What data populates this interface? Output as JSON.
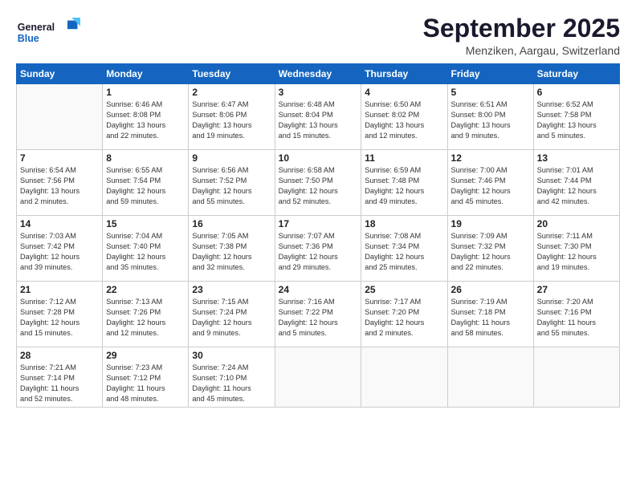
{
  "logo": {
    "general": "General",
    "blue": "Blue"
  },
  "header": {
    "month_title": "September 2025",
    "subtitle": "Menziken, Aargau, Switzerland"
  },
  "weekdays": [
    "Sunday",
    "Monday",
    "Tuesday",
    "Wednesday",
    "Thursday",
    "Friday",
    "Saturday"
  ],
  "weeks": [
    [
      {
        "day": "",
        "info": ""
      },
      {
        "day": "1",
        "info": "Sunrise: 6:46 AM\nSunset: 8:08 PM\nDaylight: 13 hours\nand 22 minutes."
      },
      {
        "day": "2",
        "info": "Sunrise: 6:47 AM\nSunset: 8:06 PM\nDaylight: 13 hours\nand 19 minutes."
      },
      {
        "day": "3",
        "info": "Sunrise: 6:48 AM\nSunset: 8:04 PM\nDaylight: 13 hours\nand 15 minutes."
      },
      {
        "day": "4",
        "info": "Sunrise: 6:50 AM\nSunset: 8:02 PM\nDaylight: 13 hours\nand 12 minutes."
      },
      {
        "day": "5",
        "info": "Sunrise: 6:51 AM\nSunset: 8:00 PM\nDaylight: 13 hours\nand 9 minutes."
      },
      {
        "day": "6",
        "info": "Sunrise: 6:52 AM\nSunset: 7:58 PM\nDaylight: 13 hours\nand 5 minutes."
      }
    ],
    [
      {
        "day": "7",
        "info": "Sunrise: 6:54 AM\nSunset: 7:56 PM\nDaylight: 13 hours\nand 2 minutes."
      },
      {
        "day": "8",
        "info": "Sunrise: 6:55 AM\nSunset: 7:54 PM\nDaylight: 12 hours\nand 59 minutes."
      },
      {
        "day": "9",
        "info": "Sunrise: 6:56 AM\nSunset: 7:52 PM\nDaylight: 12 hours\nand 55 minutes."
      },
      {
        "day": "10",
        "info": "Sunrise: 6:58 AM\nSunset: 7:50 PM\nDaylight: 12 hours\nand 52 minutes."
      },
      {
        "day": "11",
        "info": "Sunrise: 6:59 AM\nSunset: 7:48 PM\nDaylight: 12 hours\nand 49 minutes."
      },
      {
        "day": "12",
        "info": "Sunrise: 7:00 AM\nSunset: 7:46 PM\nDaylight: 12 hours\nand 45 minutes."
      },
      {
        "day": "13",
        "info": "Sunrise: 7:01 AM\nSunset: 7:44 PM\nDaylight: 12 hours\nand 42 minutes."
      }
    ],
    [
      {
        "day": "14",
        "info": "Sunrise: 7:03 AM\nSunset: 7:42 PM\nDaylight: 12 hours\nand 39 minutes."
      },
      {
        "day": "15",
        "info": "Sunrise: 7:04 AM\nSunset: 7:40 PM\nDaylight: 12 hours\nand 35 minutes."
      },
      {
        "day": "16",
        "info": "Sunrise: 7:05 AM\nSunset: 7:38 PM\nDaylight: 12 hours\nand 32 minutes."
      },
      {
        "day": "17",
        "info": "Sunrise: 7:07 AM\nSunset: 7:36 PM\nDaylight: 12 hours\nand 29 minutes."
      },
      {
        "day": "18",
        "info": "Sunrise: 7:08 AM\nSunset: 7:34 PM\nDaylight: 12 hours\nand 25 minutes."
      },
      {
        "day": "19",
        "info": "Sunrise: 7:09 AM\nSunset: 7:32 PM\nDaylight: 12 hours\nand 22 minutes."
      },
      {
        "day": "20",
        "info": "Sunrise: 7:11 AM\nSunset: 7:30 PM\nDaylight: 12 hours\nand 19 minutes."
      }
    ],
    [
      {
        "day": "21",
        "info": "Sunrise: 7:12 AM\nSunset: 7:28 PM\nDaylight: 12 hours\nand 15 minutes."
      },
      {
        "day": "22",
        "info": "Sunrise: 7:13 AM\nSunset: 7:26 PM\nDaylight: 12 hours\nand 12 minutes."
      },
      {
        "day": "23",
        "info": "Sunrise: 7:15 AM\nSunset: 7:24 PM\nDaylight: 12 hours\nand 9 minutes."
      },
      {
        "day": "24",
        "info": "Sunrise: 7:16 AM\nSunset: 7:22 PM\nDaylight: 12 hours\nand 5 minutes."
      },
      {
        "day": "25",
        "info": "Sunrise: 7:17 AM\nSunset: 7:20 PM\nDaylight: 12 hours\nand 2 minutes."
      },
      {
        "day": "26",
        "info": "Sunrise: 7:19 AM\nSunset: 7:18 PM\nDaylight: 11 hours\nand 58 minutes."
      },
      {
        "day": "27",
        "info": "Sunrise: 7:20 AM\nSunset: 7:16 PM\nDaylight: 11 hours\nand 55 minutes."
      }
    ],
    [
      {
        "day": "28",
        "info": "Sunrise: 7:21 AM\nSunset: 7:14 PM\nDaylight: 11 hours\nand 52 minutes."
      },
      {
        "day": "29",
        "info": "Sunrise: 7:23 AM\nSunset: 7:12 PM\nDaylight: 11 hours\nand 48 minutes."
      },
      {
        "day": "30",
        "info": "Sunrise: 7:24 AM\nSunset: 7:10 PM\nDaylight: 11 hours\nand 45 minutes."
      },
      {
        "day": "",
        "info": ""
      },
      {
        "day": "",
        "info": ""
      },
      {
        "day": "",
        "info": ""
      },
      {
        "day": "",
        "info": ""
      }
    ]
  ]
}
